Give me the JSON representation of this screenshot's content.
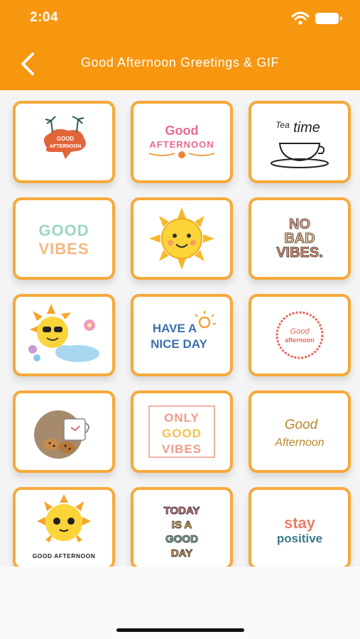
{
  "status_bar": {
    "time": "2:04"
  },
  "header": {
    "title": "Good Afternoon Greetings & GIF"
  },
  "colors": {
    "header_bg": "#f7960f",
    "tile_border": "#f6a93a"
  },
  "stickers": {
    "s1": {
      "line1": "GOOD",
      "line2": "AFTERNOON"
    },
    "s2": {
      "line1": "Good",
      "line2": "AFTERNOON"
    },
    "s3": {
      "line1": "Tea",
      "line2": "time"
    },
    "s4": {
      "line1": "GOOD",
      "line2": "VIBES"
    },
    "s5": {
      "icon": "sun-face-icon"
    },
    "s6": {
      "line1": "NO",
      "line2": "BAD",
      "line3": "VIBES."
    },
    "s7": {
      "icon": "sun-sunglasses-icon"
    },
    "s8": {
      "line1": "HAVE A",
      "line2": "NICE DAY"
    },
    "s9": {
      "line1": "Good",
      "line2": "afternoon"
    },
    "s10": {
      "icon": "coffee-cookies-icon"
    },
    "s11": {
      "line1": "ONLY",
      "line2": "GOOD",
      "line3": "VIBES"
    },
    "s12": {
      "line1": "Good",
      "line2": "Afternoon"
    },
    "s13": {
      "line1": "GOOD AFTERNOON"
    },
    "s14": {
      "line1": "TODAY",
      "line2": "IS A",
      "line3": "GOOD",
      "line4": "DAY"
    },
    "s15": {
      "line1": "stay",
      "line2": "positive"
    }
  }
}
